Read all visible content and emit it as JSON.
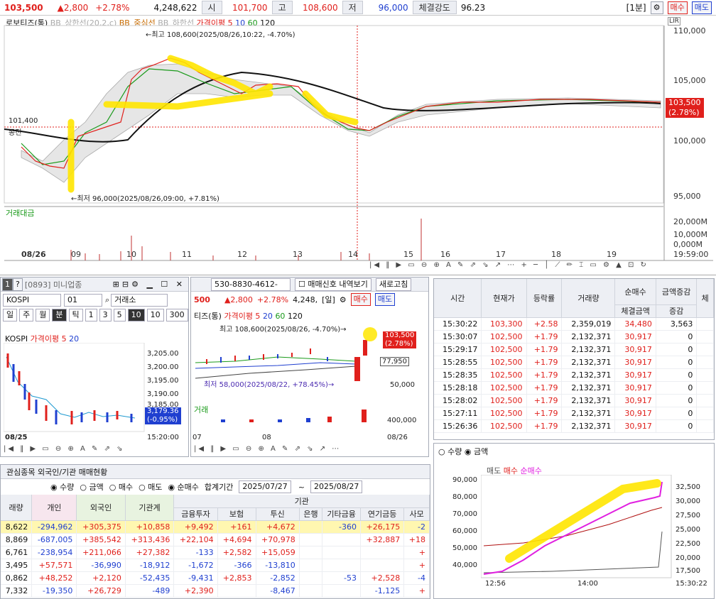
{
  "header": {
    "price": "103,500",
    "change": "▲2,800",
    "change_pct": "+2.78%",
    "volume": "4,248,622",
    "open_label": "시",
    "open": "101,700",
    "high_label": "고",
    "high": "108,600",
    "low_label": "저",
    "low": "96,000",
    "strength_label": "체결강도",
    "strength": "96.23",
    "interval": "[1분]",
    "buy": "매수",
    "sell": "매도"
  },
  "main_chart": {
    "legend": [
      "로보티즈(통)",
      "BB_상한선(20,2,c)",
      "BB_중심선",
      "BB_하한선",
      "가격이평 5",
      "10",
      "60",
      "120"
    ],
    "top_btns": "LIR",
    "high_note": "←최고 108,600(2025/08/26,10:22, -4.70%)",
    "low_note": "←최저 96,000(2025/08/26,09:00, +7.81%)",
    "ref_price": "101,400",
    "ref_sub": "종전",
    "y_ticks": [
      "110,000",
      "105,000",
      "100,000",
      "95,000"
    ],
    "cur_price": "103,500",
    "cur_pct": "(2.78%)",
    "vol_label": "거래대금",
    "vol_ticks": [
      "20,000M",
      "10,000M",
      "0,000M"
    ],
    "x_ticks": [
      "08/26",
      "09",
      "10",
      "11",
      "12",
      "13",
      "14",
      "15",
      "16",
      "17",
      "18",
      "19"
    ],
    "time": "19:59:00"
  },
  "mini": {
    "title": "[0893] 미니업종",
    "code": "01",
    "exch": "거래소",
    "name": "KOSPI",
    "ma": "가격이평 5",
    "ma2": "20",
    "periods": [
      "일",
      "주",
      "월",
      "분",
      "틱",
      "1",
      "3",
      "5",
      "10"
    ],
    "period_sel": "10",
    "count": "300",
    "y_ticks": [
      "3,205.00",
      "3,200.00",
      "3,195.00",
      "3,190.00",
      "3,185.00"
    ],
    "cur": "3,179.36",
    "cur_pct": "(-0.95%)",
    "date": "08/25",
    "time": "15:20:00"
  },
  "mid": {
    "account": "530-8830-4612-",
    "signal_cb": "매매신호 내역보기",
    "refresh": "새로고침",
    "price": "500",
    "chg": "▲2,800",
    "pct": "+2.78%",
    "vol": "4,248,",
    "day_btn": "[일]",
    "buy": "매수",
    "sell": "매도",
    "name": "티즈(통)",
    "legend": [
      "가격이평 5",
      "20",
      "60",
      "120"
    ],
    "high_note": "최고 108,600(2025/08/26, -4.70%)→",
    "low_note": "최저 58,000(2025/08/22, +78.45%)→",
    "cur": "103,500",
    "cur_pct": "(2.78%)",
    "ma_val": "77,950",
    "y50": "50,000",
    "vol_label": "거래",
    "vol_tick": "400,000",
    "x1": "07",
    "x2": "08",
    "x3": "08/26"
  },
  "trades": {
    "headers": [
      "시간",
      "현재가",
      "등락률",
      "거래량",
      "순매수",
      "금액증감",
      "체결금액",
      "증감",
      "체"
    ],
    "rows": [
      [
        "15:30:22",
        "103,300",
        "+2.58",
        "2,359,019",
        "34,480",
        "3,563"
      ],
      [
        "15:30:07",
        "102,500",
        "+1.79",
        "2,132,371",
        "30,917",
        "0"
      ],
      [
        "15:29:17",
        "102,500",
        "+1.79",
        "2,132,371",
        "30,917",
        "0"
      ],
      [
        "15:28:55",
        "102,500",
        "+1.79",
        "2,132,371",
        "30,917",
        "0"
      ],
      [
        "15:28:35",
        "102,500",
        "+1.79",
        "2,132,371",
        "30,917",
        "0"
      ],
      [
        "15:28:18",
        "102,500",
        "+1.79",
        "2,132,371",
        "30,917",
        "0"
      ],
      [
        "15:28:02",
        "102,500",
        "+1.79",
        "2,132,371",
        "30,917",
        "0"
      ],
      [
        "15:27:11",
        "102,500",
        "+1.79",
        "2,132,371",
        "30,917",
        "0"
      ],
      [
        "15:26:36",
        "102,500",
        "+1.79",
        "2,132,371",
        "30,917",
        "0"
      ]
    ]
  },
  "flow": {
    "opt1": "수량",
    "opt2": "금액",
    "legend": [
      "매도",
      "매수",
      "순매수"
    ],
    "y_left": [
      "90,000",
      "80,000",
      "70,000",
      "60,000",
      "50,000",
      "40,000"
    ],
    "y_right": [
      "32,500",
      "30,000",
      "27,500",
      "25,000",
      "22,500",
      "20,000",
      "17,500"
    ],
    "x": [
      "12:56",
      "14:00"
    ],
    "time": "15:30:22"
  },
  "investors": {
    "tab": "관심종목 외국인/기관 매매현황",
    "radio": [
      "수량",
      "금액",
      "매수",
      "매도",
      "순매수"
    ],
    "period_label": "합계기간",
    "from": "2025/07/27",
    "to": "2025/08/27",
    "group": "기관",
    "headers": [
      "래량",
      "개인",
      "외국인",
      "기관계",
      "금융투자",
      "보험",
      "투신",
      "은행",
      "기타금융",
      "연기금등",
      "사모"
    ],
    "rows": [
      [
        "8,622",
        "-294,962",
        "+305,375",
        "+10,858",
        "+9,492",
        "+161",
        "+4,672",
        "",
        "-360",
        "+26,175",
        "-2"
      ],
      [
        "8,869",
        "-687,005",
        "+385,542",
        "+313,436",
        "+22,104",
        "+4,694",
        "+70,978",
        "",
        "",
        "+32,887",
        "+18"
      ],
      [
        "6,761",
        "-238,954",
        "+211,066",
        "+27,382",
        "-133",
        "+2,582",
        "+15,059",
        "",
        "",
        "",
        "+"
      ],
      [
        "3,495",
        "+57,571",
        "-36,990",
        "-18,912",
        "-1,672",
        "-366",
        "-13,810",
        "",
        "",
        "",
        "+"
      ],
      [
        "0,862",
        "+48,252",
        "+2,120",
        "-52,435",
        "-9,431",
        "+2,853",
        "-2,852",
        "",
        "-53",
        "+2,528",
        "-4"
      ],
      [
        "7,332",
        "-19,350",
        "+26,729",
        "-489",
        "+2,390",
        "",
        "-8,467",
        "",
        "",
        "-1,125",
        "+"
      ]
    ]
  },
  "colors": {
    "up": "#e0201c",
    "down": "#1f3fd0",
    "highlight": "#ffe600"
  }
}
